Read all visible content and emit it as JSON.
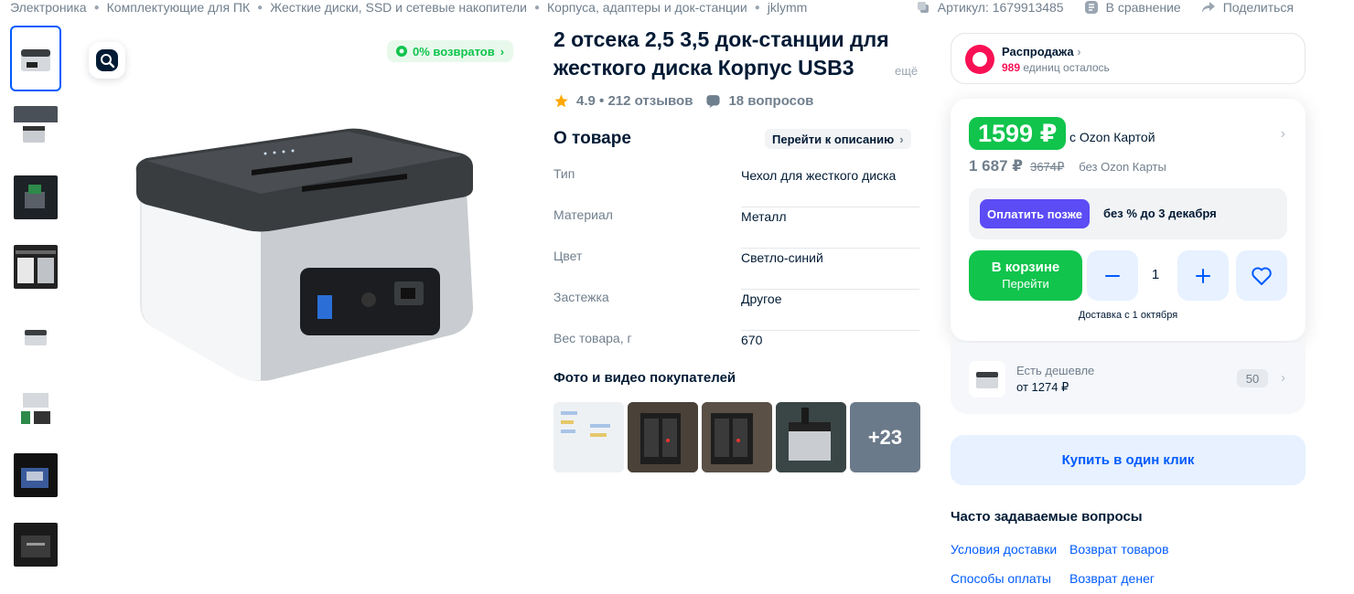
{
  "breadcrumbs": [
    "Электроника",
    "Комплектующие для ПК",
    "Жесткие диски, SSD и сетевые накопители",
    "Корпуса, адаптеры и док-станции",
    "jklymm"
  ],
  "top_actions": {
    "article": "Артикул: 1679913485",
    "compare": "В сравнение",
    "share": "Поделиться"
  },
  "gallery": {
    "returns_badge": "0% возвратов",
    "thumbnails_count": 9
  },
  "product": {
    "title": "2 отсека 2,5 3,5 док-станции для жесткого диска Корпус USB3",
    "more": "ещё",
    "rating": "4.9 • 212 отзывов",
    "questions": "18 вопросов"
  },
  "about": {
    "heading": "О товаре",
    "to_description": "Перейти к описанию",
    "specs": [
      {
        "key": "Тип",
        "value": "Чехол для жесткого диска"
      },
      {
        "key": "Материал",
        "value": "Металл"
      },
      {
        "key": "Цвет",
        "value": "Светло-синий"
      },
      {
        "key": "Застежка",
        "value": "Другое"
      },
      {
        "key": "Вес товара, г",
        "value": "670"
      }
    ]
  },
  "customer_photos": {
    "heading": "Фото и видео покупателей",
    "more_count": "+23"
  },
  "sale": {
    "title": "Распродажа",
    "remaining_count": "989",
    "remaining_text": "единиц осталось"
  },
  "price": {
    "card_price": "1599 ₽",
    "card_label": "с Ozon Картой",
    "regular_price": "1 687 ₽",
    "old_price": "3674₽",
    "regular_label": "без Ozon Карты",
    "pay_later_button": "Оплатить позже",
    "pay_later_text": "без % до 3 декабря",
    "in_cart": "В корзине",
    "go_to_cart": "Перейти",
    "quantity": "1",
    "delivery": "Доставка с 1 октября"
  },
  "cheaper": {
    "line1": "Есть дешевле",
    "line2": "от 1274 ₽",
    "count": "50"
  },
  "one_click": "Купить в один клик",
  "faq": {
    "heading": "Часто задаваемые вопросы",
    "links": [
      "Условия доставки",
      "Возврат товаров",
      "Способы оплаты",
      "Возврат денег"
    ]
  },
  "colors": {
    "accent": "#005bff",
    "green": "#10c44c",
    "pink": "#f91155",
    "paylater": "#5b4cf5"
  }
}
